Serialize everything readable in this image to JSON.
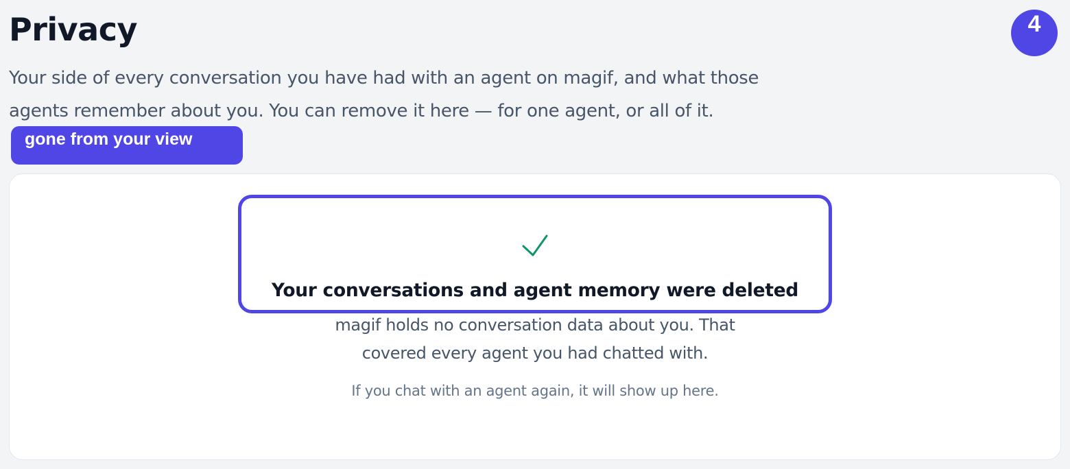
{
  "header": {
    "title": "Privacy",
    "intro": "Your side of every conversation you have had with an agent on magif, and what those agents remember about you. You can remove it here — for one agent, or all of it."
  },
  "annotation": {
    "step": "4",
    "label": "gone from your view",
    "accent": "#4f46e5"
  },
  "success": {
    "icon": "check-icon",
    "icon_color": "#10946b",
    "title": "Your conversations and agent memory were deleted",
    "body": "magif holds no conversation data about you. That covered every agent you had chatted with.",
    "note": "If you chat with an agent again, it will show up here."
  }
}
